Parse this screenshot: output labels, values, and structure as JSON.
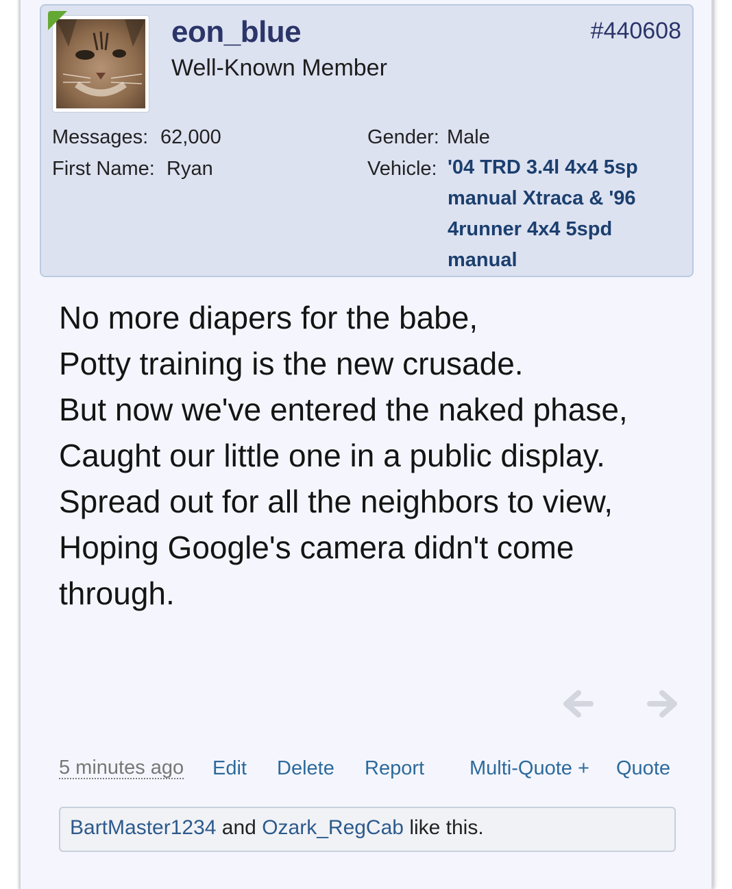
{
  "post": {
    "username": "eon_blue",
    "user_title": "Well-Known Member",
    "post_number": "#440608",
    "stats": {
      "messages_label": "Messages:",
      "messages_value": "62,000",
      "first_name_label": "First Name:",
      "first_name_value": "Ryan",
      "gender_label": "Gender:",
      "gender_value": "Male",
      "vehicle_label": "Vehicle:",
      "vehicle_value": "'04 TRD 3.4l 4x4 5sp manual Xtraca & '96 4runner 4x4 5spd manual"
    },
    "body": "No more diapers for the babe,\nPotty training is the new crusade.\nBut now we've entered the naked phase,\nCaught our little one in a public display.\nSpread out for all the neighbors to view,\nHoping Google's camera didn't come through.",
    "controls": {
      "date": "5 minutes ago",
      "edit": "Edit",
      "delete": "Delete",
      "report": "Report",
      "multi_quote": "Multi-Quote +",
      "quote": "Quote"
    },
    "likes": {
      "user1": "BartMaster1234",
      "and": "and",
      "user2": "Ozark_RegCab",
      "suffix": "like this."
    }
  },
  "icons": {
    "prev": "arrow-left-icon",
    "next": "arrow-right-icon",
    "online": "online-indicator-icon"
  },
  "colors": {
    "username": "#2b3568",
    "link": "#2c6a9c",
    "userinfo_bg": "#dde2f1",
    "post_bg": "#f5f6fd",
    "online": "#64a834"
  }
}
